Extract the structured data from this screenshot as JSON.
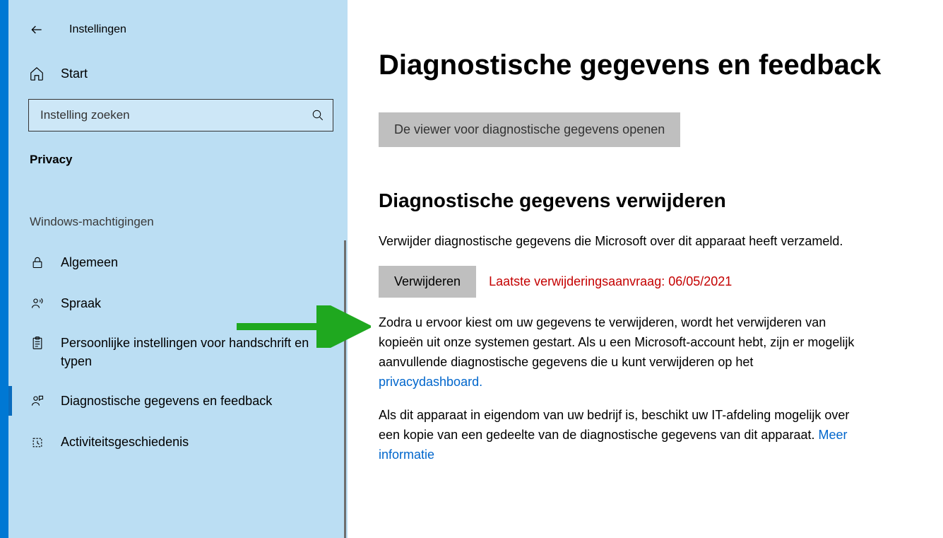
{
  "header": {
    "title": "Instellingen"
  },
  "home": {
    "label": "Start"
  },
  "search": {
    "placeholder": "Instelling zoeken"
  },
  "category": "Privacy",
  "nav_group": "Windows-machtigingen",
  "nav": [
    {
      "label": "Algemeen"
    },
    {
      "label": "Spraak"
    },
    {
      "label": "Persoonlijke instellingen voor handschrift en typen"
    },
    {
      "label": "Diagnostische gegevens en feedback"
    },
    {
      "label": "Activiteitsgeschiedenis"
    }
  ],
  "main": {
    "title": "Diagnostische gegevens en feedback",
    "open_viewer_button": "De viewer voor diagnostische gegevens openen",
    "delete_section_title": "Diagnostische gegevens verwijderen",
    "delete_intro": "Verwijder diagnostische gegevens die Microsoft over dit apparaat heeft verzameld.",
    "delete_button": "Verwijderen",
    "delete_status": "Laatste verwijderingsaanvraag: 06/05/2021",
    "para1_pre": "Zodra u ervoor kiest om uw gegevens te verwijderen, wordt het verwijderen van kopieën uit onze systemen gestart. Als u een Microsoft-account hebt, zijn er mogelijk aanvullende diagnostische gegevens die u kunt verwijderen op het ",
    "para1_link": "privacydashboard.",
    "para2_pre": "Als dit apparaat in eigendom van uw bedrijf is, beschikt uw IT-afdeling mogelijk over een kopie van een gedeelte van de diagnostische gegevens van dit apparaat. ",
    "para2_link": "Meer informatie"
  }
}
